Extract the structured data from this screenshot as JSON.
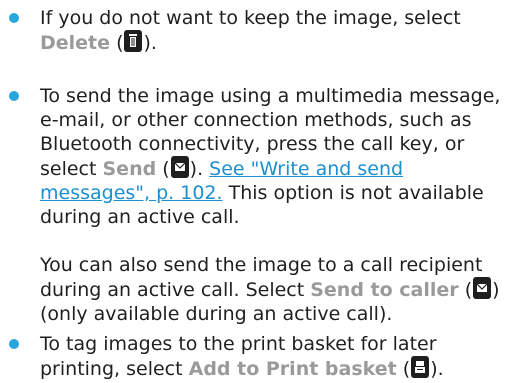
{
  "items": [
    {
      "lines": [
        [
          "If you do not want to keep the image, select"
        ],
        [
          {
            "t": "ui",
            "v": "Delete"
          },
          " (",
          {
            "icon": "trash-icon"
          },
          ")."
        ]
      ]
    },
    {
      "lines": [
        [
          "To send the image using a multimedia message,"
        ],
        [
          "e-mail, or other connection methods, such as"
        ],
        [
          "Bluetooth connectivity, press the call key, or"
        ],
        [
          "select ",
          {
            "t": "ui",
            "v": "Send"
          },
          " (",
          {
            "icon": "envelope-icon"
          },
          "). ",
          {
            "t": "link",
            "v": "See \"Write and send"
          }
        ],
        [
          {
            "t": "link",
            "v": "messages\", p. 102."
          },
          " This option is not available"
        ],
        [
          "during an active call."
        ],
        [
          ""
        ],
        [
          "You can also send the image to a call recipient"
        ],
        [
          "during an active call. Select ",
          {
            "t": "ui",
            "v": "Send to caller"
          },
          " (",
          {
            "icon": "envelope-icon"
          },
          ")"
        ],
        [
          "(only available during an active call)."
        ]
      ]
    },
    {
      "lines": [
        [
          "To tag images to the print basket for later"
        ],
        [
          "printing, select ",
          {
            "t": "ui",
            "v": "Add to Print basket"
          },
          " (",
          {
            "icon": "print-basket-icon"
          },
          ")."
        ]
      ]
    }
  ],
  "colors": {
    "bullet": "#28a7de",
    "ui_label": "#9a9a9a",
    "link": "#1b8fd0"
  }
}
